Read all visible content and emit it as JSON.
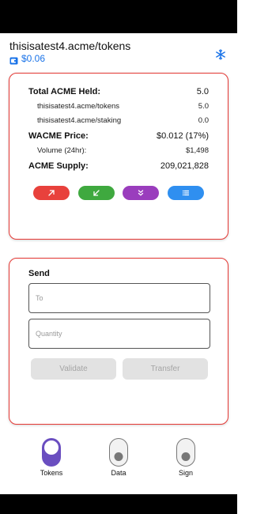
{
  "header": {
    "account": "thisisatest4.acme/tokens",
    "balance": "$0.06"
  },
  "summary": {
    "total_label": "Total ACME Held:",
    "total_value": "5.0",
    "accounts": [
      {
        "name": "thisisatest4.acme/tokens",
        "value": "5.0"
      },
      {
        "name": "thisisatest4.acme/staking",
        "value": "0.0"
      }
    ],
    "price_label": "WACME Price:",
    "price_value": "$0.012 (17%)",
    "volume_label": "Volume (24hr):",
    "volume_value": "$1,498",
    "supply_label": "ACME Supply:",
    "supply_value": "209,021,828"
  },
  "actions": [
    {
      "icon": "arrow-up-right-icon",
      "color": "#e8413c"
    },
    {
      "icon": "arrow-down-left-icon",
      "color": "#3fa93f"
    },
    {
      "icon": "double-chevron-down-icon",
      "color": "#9a3dbd"
    },
    {
      "icon": "list-icon",
      "color": "#2f8ff0"
    }
  ],
  "send": {
    "title": "Send",
    "to_placeholder": "To",
    "quantity_placeholder": "Quantity",
    "validate_label": "Validate",
    "transfer_label": "Transfer"
  },
  "tabs": [
    {
      "label": "Tokens",
      "active": true
    },
    {
      "label": "Data",
      "active": false
    },
    {
      "label": "Sign",
      "active": false
    }
  ],
  "colors": {
    "accent": "#1a73e8",
    "card_border": "#e53935",
    "active_tab": "#6a4ec0"
  }
}
